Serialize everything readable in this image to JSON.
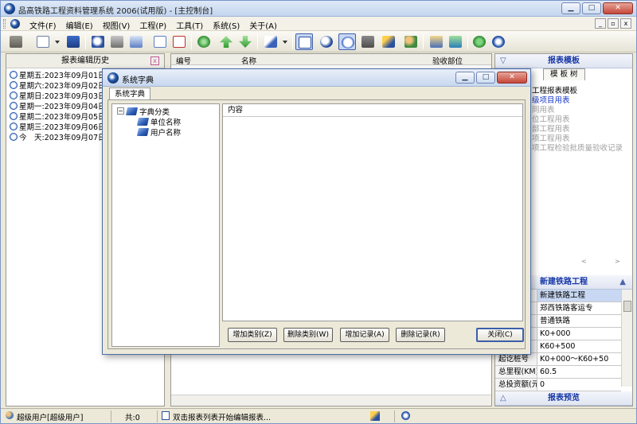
{
  "window": {
    "title": "品高铁路工程资料管理系统 2006(试用版) - [主控制台]",
    "minimize": "▁",
    "restore": "□",
    "close": "✕"
  },
  "menu": {
    "items": [
      "文件(F)",
      "编辑(E)",
      "视图(V)",
      "工程(P)",
      "工具(T)",
      "系统(S)",
      "关于(A)"
    ],
    "mdi_minimize": "_",
    "mdi_restore": "▫",
    "mdi_close": "x"
  },
  "left_panel": {
    "title": "报表编辑历史",
    "close": "x",
    "history": [
      "星期五:2023年09月01日",
      "星期六:2023年09月02日",
      "星期日:2023年09月03日",
      "星期一:2023年09月04日",
      "星期二:2023年09月05日",
      "星期三:2023年09月06日",
      "今　天:2023年09月07日"
    ]
  },
  "report_list": {
    "columns": [
      "编号",
      "名称",
      "验收部位"
    ]
  },
  "right_panel": {
    "template_header": "报表模板",
    "tab_tree": "模 板 树",
    "tree": [
      "工程报表模板",
      "级项目用表",
      "同用表",
      "位工程用表",
      "部工程用表",
      "项工程用表",
      "项工程检验批质量验收记录"
    ],
    "scroll_hint_left": "<",
    "scroll_hint_right": ">",
    "project_header": "新建铁路工程",
    "props": [
      {
        "key": "",
        "value": "新建铁路工程"
      },
      {
        "key": "",
        "value": "郑西铁路客运专"
      },
      {
        "key": "",
        "value": "普通铁路"
      },
      {
        "key": "",
        "value": "K0+000"
      },
      {
        "key": "",
        "value": "K60+500"
      },
      {
        "key": "起讫桩号",
        "value": "K0+000～K60+50"
      },
      {
        "key": "总里程(KM)",
        "value": "60.5"
      },
      {
        "key": "总投资额(元)",
        "value": "0"
      }
    ],
    "preview_header": "报表预览"
  },
  "status": {
    "user": "超级用户[超级用户]",
    "count": "共:0",
    "hint": "双击报表列表开始编辑报表..."
  },
  "dialog": {
    "title": "系统字典",
    "tab": "系统字典",
    "tree_root": "字典分类",
    "tree_children": [
      "单位名称",
      "用户名称"
    ],
    "content_header": "内容",
    "buttons": {
      "add_category": "增加类别(Z)",
      "delete_category": "删除类别(W)",
      "add_record": "增加记录(A)",
      "delete_record": "删除记录(R)",
      "close": "关闭(C)"
    }
  }
}
